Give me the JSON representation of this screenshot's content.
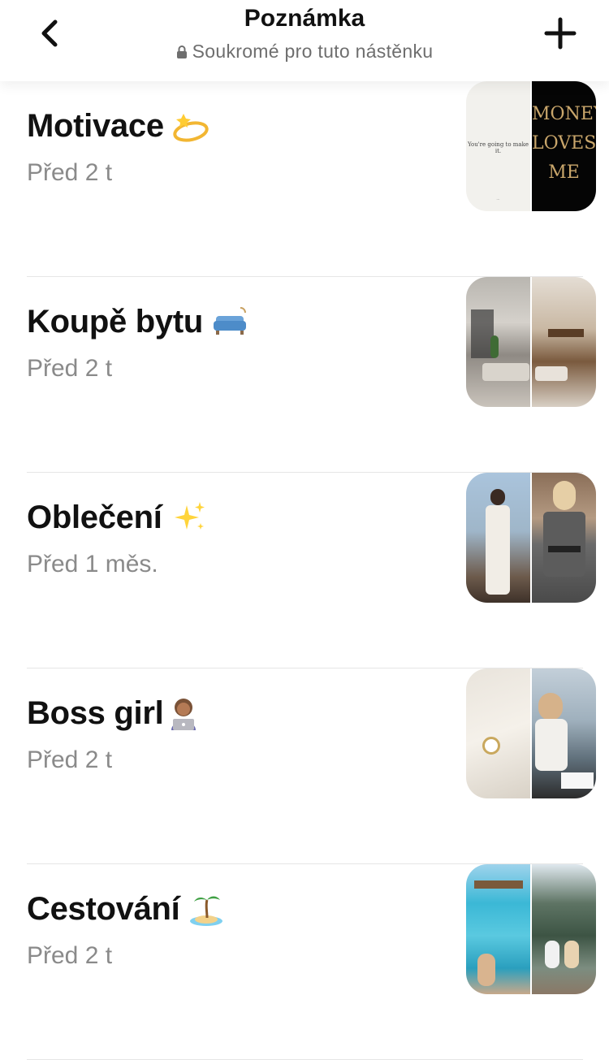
{
  "header": {
    "title": "Poznámka",
    "subtitle": "Soukromé pro tuto nástěnku"
  },
  "boards": [
    {
      "title": "Motivace",
      "emoji": "dizzy-icon",
      "time": "Před 2 t",
      "cover_left_text": "You're going to make it.",
      "cover_left_small": "...",
      "cover_right_text": [
        "MONEY",
        "LOVES",
        "ME"
      ]
    },
    {
      "title": "Koupě bytu",
      "emoji": "couch-icon",
      "time": "Před 2 t"
    },
    {
      "title": "Oblečení",
      "emoji": "sparkles-icon",
      "time": "Před 1 měs."
    },
    {
      "title": "Boss girl",
      "emoji": "technologist-icon",
      "time": "Před 2 t"
    },
    {
      "title": "Cestování",
      "emoji": "island-icon",
      "time": "Před 2 t"
    }
  ],
  "colors": {
    "text": "#111111",
    "muted": "#8a8a8a",
    "divider": "#e6e6e6",
    "money_gold": "#c9a66b"
  }
}
